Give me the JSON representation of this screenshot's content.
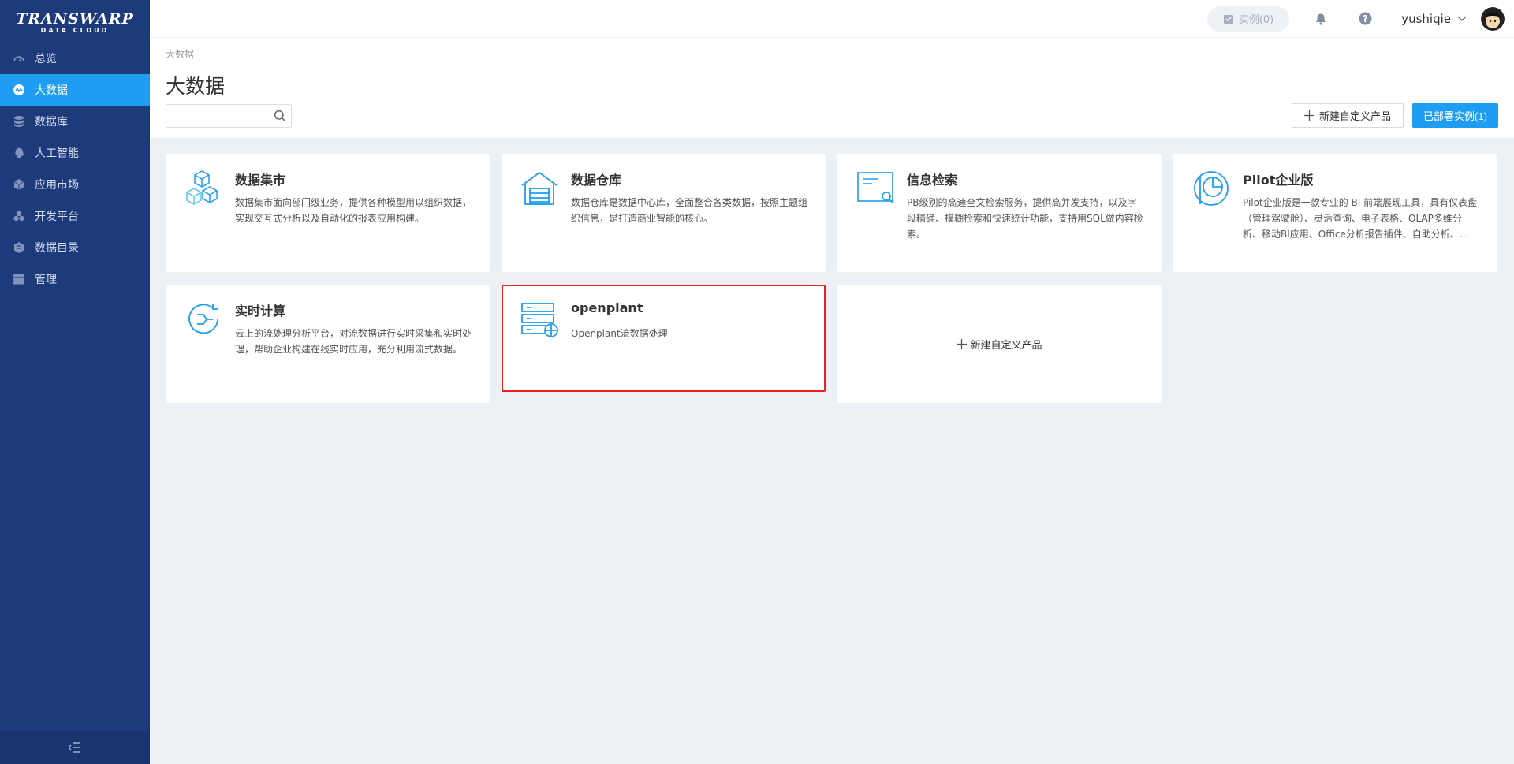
{
  "logo": {
    "main": "TRANSWARP",
    "sub": "DATA CLOUD"
  },
  "sidebar": {
    "items": [
      {
        "label": "总览",
        "icon": "dashboard-icon"
      },
      {
        "label": "大数据",
        "icon": "bigdata-icon",
        "active": true
      },
      {
        "label": "数据库",
        "icon": "database-icon"
      },
      {
        "label": "人工智能",
        "icon": "ai-head-icon"
      },
      {
        "label": "应用市场",
        "icon": "box-icon"
      },
      {
        "label": "开发平台",
        "icon": "cluster-icon"
      },
      {
        "label": "数据目录",
        "icon": "catalog-icon"
      },
      {
        "label": "管理",
        "icon": "server-icon"
      }
    ],
    "collapse_icon": "collapse-menu-icon"
  },
  "header": {
    "instances_label": "实例(0)",
    "username": "yushiqie"
  },
  "page": {
    "breadcrumb": "大数据",
    "title": "大数据",
    "search_placeholder": "",
    "new_product_label": "新建自定义产品",
    "deployed_label": "已部署实例(1)"
  },
  "cards": [
    {
      "title": "数据集市",
      "desc": "数据集市面向部门级业务，提供各种模型用以组织数据，实现交互式分析以及自动化的报表应用构建。",
      "icon": "cubes-icon"
    },
    {
      "title": "数据仓库",
      "desc": "数据仓库是数据中心库，全面整合各类数据，按照主题组织信息，是打造商业智能的核心。",
      "icon": "warehouse-icon"
    },
    {
      "title": "信息检索",
      "desc": "PB级别的高速全文检索服务，提供高并发支持，以及字段精确、模糊检索和快速统计功能，支持用SQL做内容检索。",
      "icon": "search-window-icon"
    },
    {
      "title": "Pilot企业版",
      "desc": "Pilot企业版是一款专业的 BI 前端展现工具，具有仪表盘（管理驾驶舱）、灵活查询、电子表格、OLAP多维分析、移动BI应用、Office分析报告插件、自助分析、…",
      "icon": "pie-chart-icon"
    },
    {
      "title": "实时计算",
      "desc": "云上的流处理分析平台，对流数据进行实时采集和实时处理，帮助企业构建在线实时应用，充分利用流式数据。",
      "icon": "stream-icon"
    },
    {
      "title": "openplant",
      "desc": "Openplant流数据处理",
      "icon": "server-globe-icon"
    }
  ],
  "new_card_label": "新建自定义产品",
  "colors": {
    "sidebar": "#1d3a7b",
    "active": "#1e9df2",
    "highlight": "#e8211e"
  }
}
